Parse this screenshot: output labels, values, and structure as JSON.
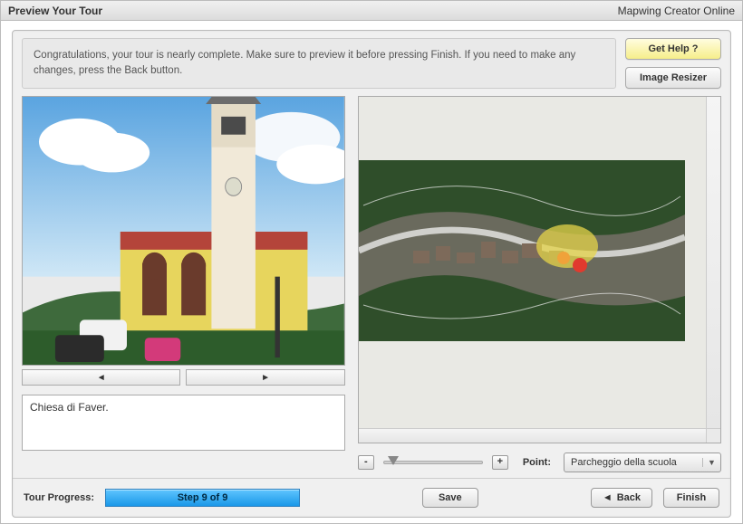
{
  "titlebar": {
    "left": "Preview Your Tour",
    "right": "Mapwing Creator Online"
  },
  "instructions": "Congratulations, your tour is nearly complete. Make sure to preview it before pressing Finish. If you need to make any changes, press the Back button.",
  "side_buttons": {
    "help": "Get Help ?",
    "resizer": "Image Resizer"
  },
  "nav": {
    "prev_glyph": "◄",
    "next_glyph": "►"
  },
  "caption": "Chiesa di Faver.",
  "zoom": {
    "minus": "-",
    "plus": "+"
  },
  "point": {
    "label": "Point:",
    "selected": "Parcheggio della scuola",
    "arrow_glyph": "▼"
  },
  "bottom": {
    "progress_label": "Tour Progress:",
    "progress_text": "Step 9 of 9",
    "save": "Save",
    "back": "Back",
    "back_glyph": "◄",
    "finish": "Finish"
  }
}
